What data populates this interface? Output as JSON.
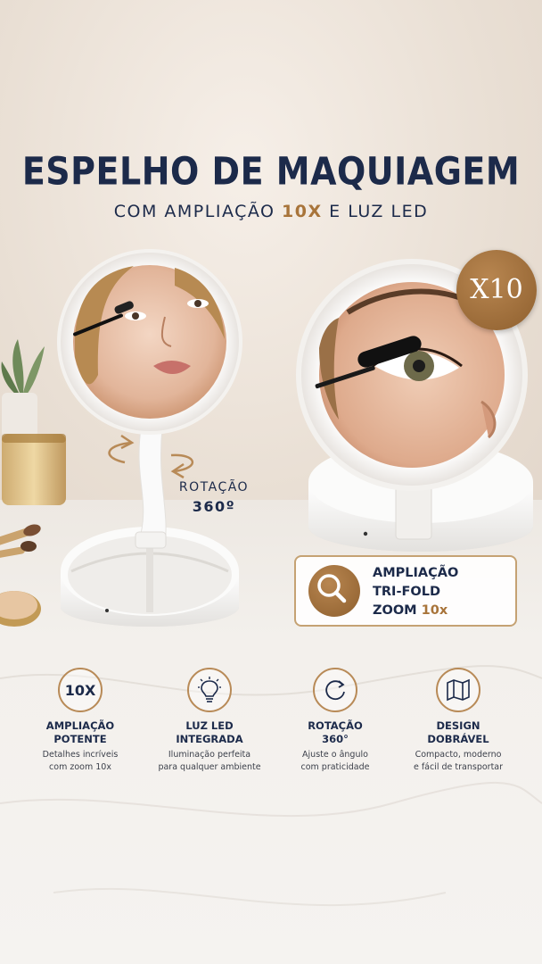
{
  "header": {
    "title": "ESPELHO DE MAQUIAGEM",
    "subtitle_pre": "COM AMPLIAÇÃO ",
    "subtitle_highlight": "10X",
    "subtitle_post": " E LUZ LED"
  },
  "rotation_label": {
    "line1": "ROTAÇÃO",
    "line2": "360º"
  },
  "badge": {
    "label": "X10"
  },
  "zoom_box": {
    "line1": "AMPLIAÇÃO",
    "line2": "TRI-FOLD",
    "line3_pre": "ZOOM ",
    "line3_highlight": "10x",
    "icon": "magnifier-icon"
  },
  "features": [
    {
      "icon": "10x-icon",
      "icon_text": "10X",
      "title1": "AMPLIAÇÃO",
      "title2": "POTENTE",
      "desc1": "Detalhes incríveis",
      "desc2": "com zoom 10x"
    },
    {
      "icon": "lightbulb-icon",
      "icon_text": "",
      "title1": "LUZ LED",
      "title2": "INTEGRADA",
      "desc1": "Iluminação perfeita",
      "desc2": "para qualquer ambiente"
    },
    {
      "icon": "rotation-icon",
      "icon_text": "",
      "title1": "ROTAÇÃO",
      "title2": "360°",
      "desc1": "Ajuste o ângulo",
      "desc2": "com praticidade"
    },
    {
      "icon": "folding-map-icon",
      "icon_text": "",
      "title1": "DESIGN",
      "title2": "DOBRÁVEL",
      "desc1": "Compacto, moderno",
      "desc2": "e fácil de transportar"
    }
  ],
  "colors": {
    "navy": "#1c2a4a",
    "gold": "#a8743a",
    "badge": "#9a6a36"
  }
}
